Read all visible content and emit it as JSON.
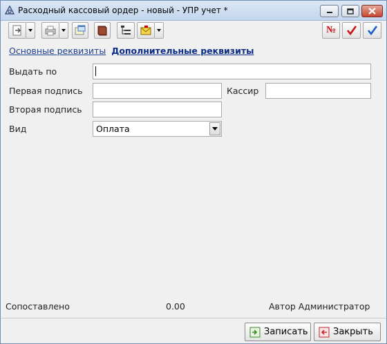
{
  "window": {
    "title": "Расходный кассовый ордер - новый - УПР учет *"
  },
  "toolbar": {
    "buttons": [
      {
        "icon": "document-arrow-icon"
      },
      {
        "icon": "printer-icon"
      },
      {
        "icon": "open-in-new-window-icon"
      },
      {
        "icon": "book-icon"
      },
      {
        "icon": "structure-tree-icon"
      },
      {
        "icon": "envelope-icon"
      },
      {
        "icon": "number-icon"
      },
      {
        "icon": "checkmark-red-icon"
      },
      {
        "icon": "checkmark-blue-icon"
      }
    ],
    "number_label": "№"
  },
  "tabs": [
    {
      "label": "Основные реквизиты",
      "active": false
    },
    {
      "label": "Дополнительные реквизиты",
      "active": true
    }
  ],
  "form": {
    "issue_to": {
      "label": "Выдать по",
      "value": ""
    },
    "first_signature": {
      "label": "Первая подпись",
      "value": ""
    },
    "cashier": {
      "label": "Кассир",
      "value": ""
    },
    "second_signature": {
      "label": "Вторая подпись",
      "value": ""
    },
    "kind": {
      "label": "Вид",
      "value": "Оплата"
    }
  },
  "status": {
    "matched_label": "Сопоставлено",
    "matched_value": "0.00",
    "author": "Автор Администратор"
  },
  "footer": {
    "save_label": "Записать",
    "close_label": "Закрыть"
  },
  "colors": {
    "active_tab": "#0b2c86",
    "tab_link": "#1d3f8f",
    "close_button": "#c5462f"
  }
}
